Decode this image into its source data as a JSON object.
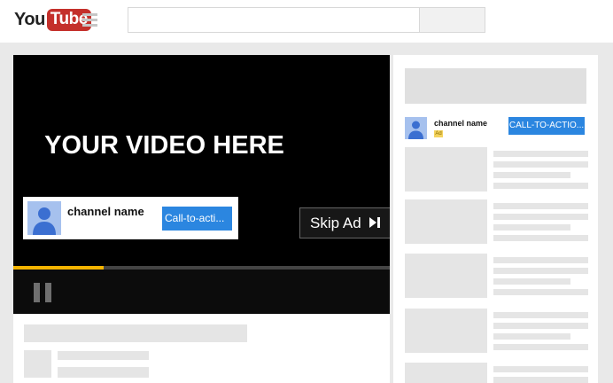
{
  "header": {
    "logo_you": "You",
    "logo_tube": "Tube",
    "search_placeholder": ""
  },
  "player": {
    "video_title": "YOUR VIDEO HERE",
    "overlay": {
      "channel_name": "channel name",
      "cta_label": "Call-to-acti..."
    },
    "skip_ad_label": "Skip Ad",
    "progress_fraction": 0.24
  },
  "sidebar": {
    "channel_name": "channel name",
    "ad_badge": "Ad",
    "cta_label": "CALL-TO-ACTIO..."
  },
  "colors": {
    "brand_red": "#c4302b",
    "cta_blue": "#2b86e0",
    "progress_yellow": "#f4b400",
    "placeholder_gray": "#e5e5e5"
  },
  "icons": {
    "skip": "skip-next-icon",
    "pause": "pause-icon",
    "avatar": "user-avatar-icon",
    "menu": "hamburger-menu-icon"
  }
}
